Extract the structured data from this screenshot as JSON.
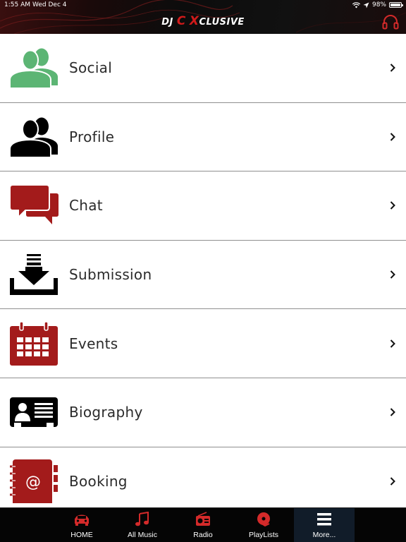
{
  "status_bar": {
    "time": "1:55 AM",
    "date": "Wed Dec 4",
    "battery": "98%",
    "battery_level": 0.98
  },
  "header": {
    "logo_prefix": "DJ",
    "logo_accent_1": "C",
    "logo_accent_2": "X",
    "logo_suffix": "CLUSIVE",
    "right_icon": "headphones-icon",
    "accent_color": "#c81d1d"
  },
  "menu": {
    "items": [
      {
        "label": "Social",
        "icon": "social-people-icon",
        "icon_color": "#5cb574"
      },
      {
        "label": "Profile",
        "icon": "profile-people-icon",
        "icon_color": "#000000"
      },
      {
        "label": "Chat",
        "icon": "chat-bubbles-icon",
        "icon_color": "#a31b1b"
      },
      {
        "label": "Submission",
        "icon": "download-tray-icon",
        "icon_color": "#000000"
      },
      {
        "label": "Events",
        "icon": "calendar-icon",
        "icon_color": "#a31b1b"
      },
      {
        "label": "Biography",
        "icon": "id-card-icon",
        "icon_color": "#000000"
      },
      {
        "label": "Booking",
        "icon": "address-book-icon",
        "icon_color": "#a31b1b"
      }
    ]
  },
  "tab_bar": {
    "tabs": [
      {
        "label": "HOME",
        "icon": "car-icon"
      },
      {
        "label": "All Music",
        "icon": "music-note-icon"
      },
      {
        "label": "Radio",
        "icon": "radio-icon"
      },
      {
        "label": "PlayLists",
        "icon": "playlist-disc-icon"
      },
      {
        "label": "More...",
        "icon": "hamburger-menu-icon",
        "active": true
      }
    ],
    "icon_color": "#d42a2a",
    "active_background": "#111c29"
  }
}
